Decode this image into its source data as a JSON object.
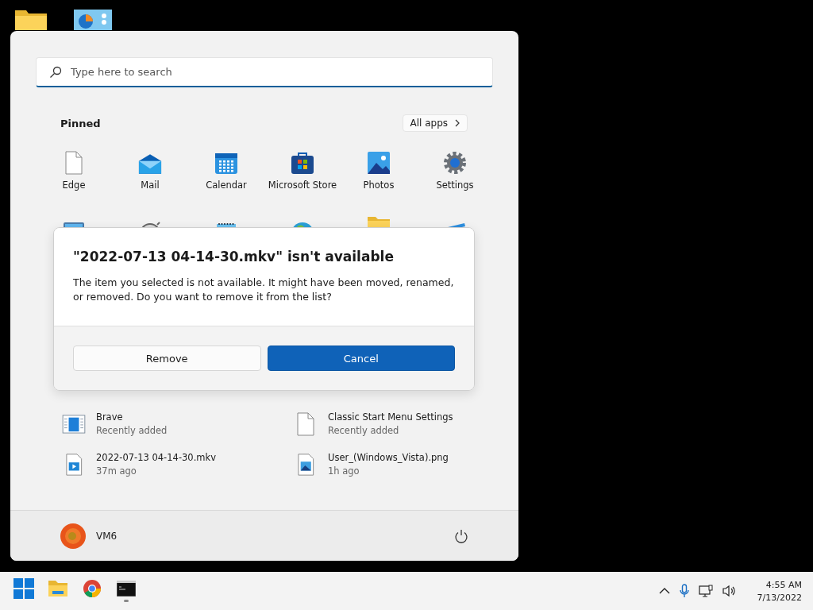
{
  "search": {
    "placeholder": "Type here to search"
  },
  "pinned": {
    "title": "Pinned",
    "all_apps": "All apps",
    "apps": [
      {
        "label": "Edge",
        "kind": "doc"
      },
      {
        "label": "Mail",
        "kind": "mail"
      },
      {
        "label": "Calendar",
        "kind": "calendar"
      },
      {
        "label": "Microsoft Store",
        "kind": "store"
      },
      {
        "label": "Photos",
        "kind": "photos"
      },
      {
        "label": "Settings",
        "kind": "gear"
      },
      {
        "kind": "monitor"
      },
      {
        "kind": "clock"
      },
      {
        "kind": "notepad"
      },
      {
        "kind": "globe"
      },
      {
        "kind": "folder"
      },
      {
        "kind": "clapper"
      }
    ]
  },
  "dialog": {
    "title": "\"2022-07-13 04-14-30.mkv\" isn't available",
    "message": "The item you selected is not available. It might have been moved, renamed, or removed. Do you want to remove it from the list?",
    "buttons": [
      {
        "label": "Remove",
        "kind": "secondary"
      },
      {
        "label": "Cancel",
        "kind": "primary"
      }
    ]
  },
  "recommended": [
    {
      "name": "Brave",
      "detail": "Recently added",
      "kind": "window"
    },
    {
      "name": "Classic Start Menu Settings",
      "detail": "Recently added",
      "kind": "doc"
    },
    {
      "name": "2022-07-13 04-14-30.mkv",
      "detail": "37m ago",
      "kind": "video"
    },
    {
      "name": "User_(Windows_Vista).png",
      "detail": "1h ago",
      "kind": "image"
    }
  ],
  "user": {
    "name": "VM6"
  },
  "taskbar": {
    "apps": [
      {
        "kind": "start",
        "running": false
      },
      {
        "kind": "folder",
        "running": false
      },
      {
        "kind": "chrome",
        "running": false
      },
      {
        "kind": "terminal",
        "running": true
      }
    ],
    "time": "4:55 AM",
    "date": "7/13/2022"
  }
}
